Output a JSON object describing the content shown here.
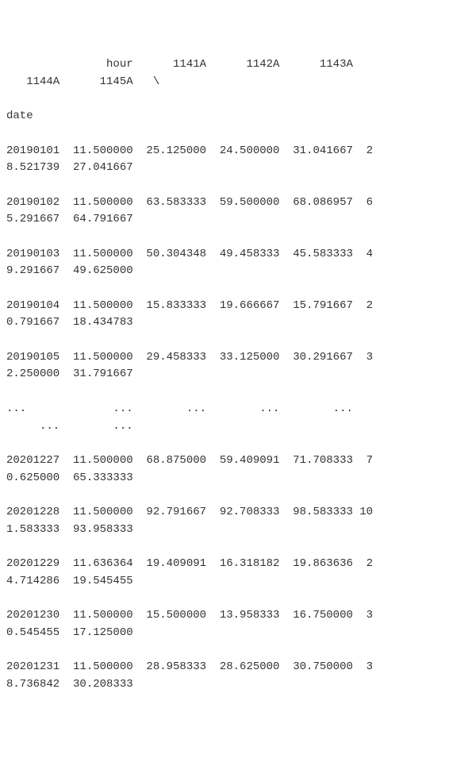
{
  "header": {
    "line1": "               hour      1141A      1142A      1143A      1144A      1145A   \\",
    "line2": "date"
  },
  "rows": [
    "20190101  11.500000  25.125000  24.500000  31.041667  28.521739  27.041667",
    "20190102  11.500000  63.583333  59.500000  68.086957  65.291667  64.791667",
    "20190103  11.500000  50.304348  49.458333  45.583333  49.291667  49.625000",
    "20190104  11.500000  15.833333  19.666667  15.791667  20.791667  18.434783",
    "20190105  11.500000  29.458333  33.125000  30.291667  32.250000  31.791667",
    "...             ...        ...        ...        ...        ...        ...",
    "20201227  11.500000  68.875000  59.409091  71.708333  70.625000  65.333333",
    "20201228  11.500000  92.791667  92.708333  98.583333 101.583333  93.958333",
    "20201229  11.636364  19.409091  16.318182  19.863636  24.714286  19.545455",
    "20201230  11.500000  15.500000  13.958333  16.750000  30.545455  17.125000",
    "20201231  11.500000  28.958333  28.625000  30.750000  38.736842  30.208333"
  ],
  "table": {
    "index_name": "date",
    "columns": [
      "hour",
      "1141A",
      "1142A",
      "1143A",
      "1144A",
      "1145A"
    ],
    "index": [
      "20190101",
      "20190102",
      "20190103",
      "20190104",
      "20190105",
      "...",
      "20201227",
      "20201228",
      "20201229",
      "20201230",
      "20201231"
    ],
    "data": [
      [
        11.5,
        25.125,
        24.5,
        31.041667,
        28.521739,
        27.041667
      ],
      [
        11.5,
        63.583333,
        59.5,
        68.086957,
        65.291667,
        64.791667
      ],
      [
        11.5,
        50.304348,
        49.458333,
        45.583333,
        49.291667,
        49.625
      ],
      [
        11.5,
        15.833333,
        19.666667,
        15.791667,
        20.791667,
        18.434783
      ],
      [
        11.5,
        29.458333,
        33.125,
        30.291667,
        32.25,
        31.791667
      ],
      [
        "...",
        "...",
        "...",
        "...",
        "...",
        "..."
      ],
      [
        11.5,
        68.875,
        59.409091,
        71.708333,
        70.625,
        65.333333
      ],
      [
        11.5,
        92.791667,
        92.708333,
        98.583333,
        101.583333,
        93.958333
      ],
      [
        11.636364,
        19.409091,
        16.318182,
        19.863636,
        24.714286,
        19.545455
      ],
      [
        11.5,
        15.5,
        13.958333,
        16.75,
        30.545455,
        17.125
      ],
      [
        11.5,
        28.958333,
        28.625,
        30.75,
        38.736842,
        30.208333
      ]
    ]
  }
}
